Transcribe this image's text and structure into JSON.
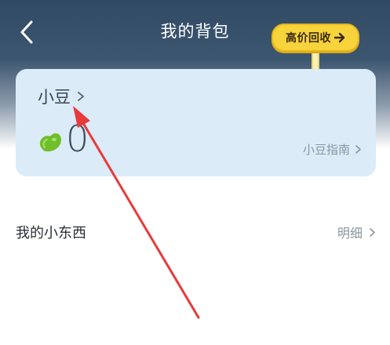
{
  "header": {
    "title": "我的背包",
    "back_icon": "back-arrow-icon",
    "recycle_button": {
      "label": "高价回收",
      "icon": "arrow-right-icon"
    }
  },
  "bean_card": {
    "title": "小豆",
    "title_icon": "chevron-right-icon",
    "bean_icon": "green-bean-icon",
    "count": "0",
    "guide_label": "小豆指南",
    "guide_icon": "chevron-right-icon"
  },
  "items_section": {
    "title": "我的小东西",
    "detail_label": "明细",
    "detail_icon": "chevron-right-icon"
  },
  "colors": {
    "header_dark": "#314a64",
    "card_bg": "#dbebf8",
    "recycle_yellow": "#f7d33c",
    "bean_green": "#6fbf2a",
    "annotation_red": "#e83a3a"
  }
}
